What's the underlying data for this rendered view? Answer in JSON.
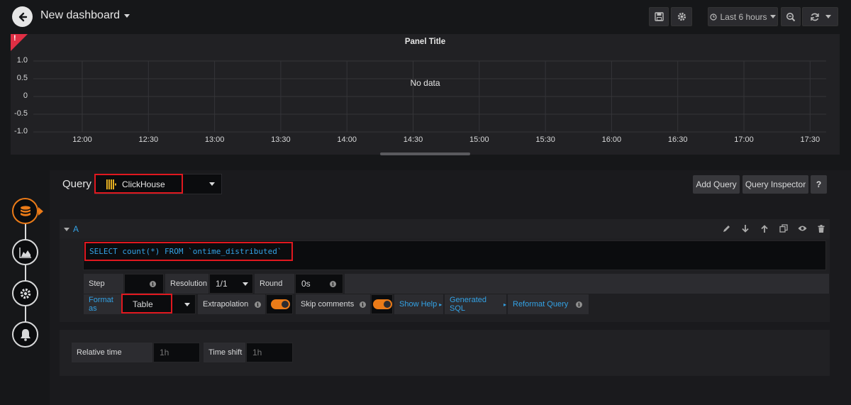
{
  "header": {
    "title": "New dashboard",
    "time_range": "Last 6 hours"
  },
  "panel": {
    "title": "Panel Title",
    "no_data": "No data",
    "error_mark": "!",
    "y_ticks": [
      "1.0",
      "0.5",
      "0",
      "-0.5",
      "-1.0"
    ],
    "x_ticks": [
      "12:00",
      "12:30",
      "13:00",
      "13:30",
      "14:00",
      "14:30",
      "15:00",
      "15:30",
      "16:00",
      "16:30",
      "17:00",
      "17:30"
    ]
  },
  "editor": {
    "query_label": "Query",
    "datasource": "ClickHouse",
    "add_query": "Add Query",
    "query_inspector": "Query Inspector",
    "help": "?"
  },
  "query": {
    "ref_id": "A",
    "sql": "SELECT count(*) FROM `ontime_distributed`",
    "step_label": "Step",
    "step_value": "",
    "resolution_label": "Resolution",
    "resolution_value": "1/1",
    "round_label": "Round",
    "round_value": "0s",
    "format_label": "Format as",
    "format_value": "Table",
    "extrapolation_label": "Extrapolation",
    "skip_comments_label": "Skip comments",
    "show_help": "Show Help",
    "generated_sql": "Generated SQL",
    "reformat_query": "Reformat Query"
  },
  "options": {
    "relative_time_label": "Relative time",
    "relative_time_placeholder": "1h",
    "time_shift_label": "Time shift",
    "time_shift_placeholder": "1h"
  },
  "colors": {
    "accent_orange": "#eb7b18",
    "link_blue": "#33a2e5",
    "error_red": "#e02f44",
    "highlight_red": "#e0181f"
  }
}
